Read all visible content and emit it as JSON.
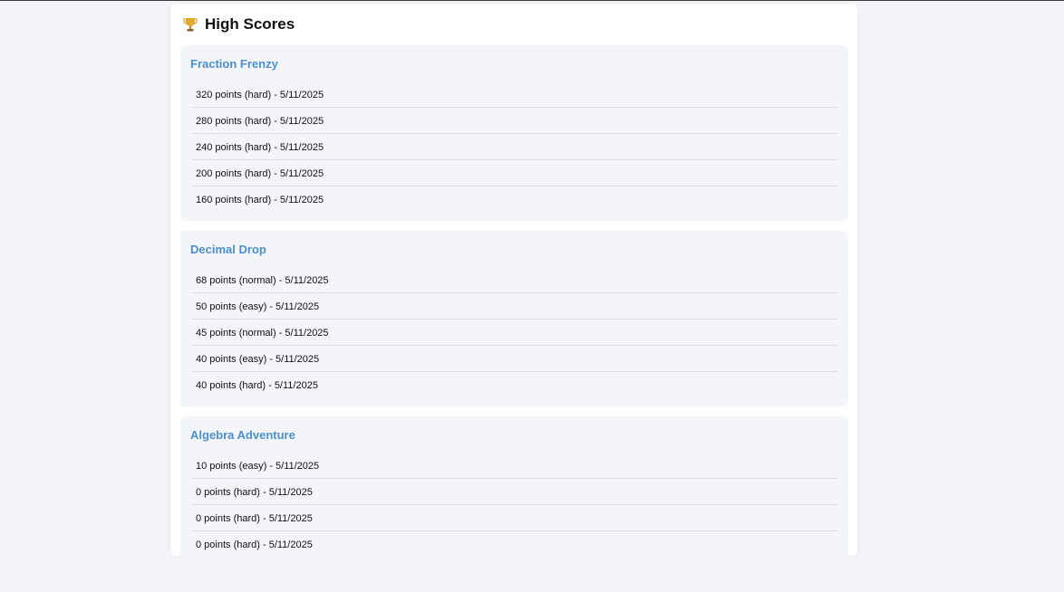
{
  "header": {
    "title": "High Scores",
    "icon": "trophy-icon"
  },
  "games": [
    {
      "name": "Fraction Frenzy",
      "scores": [
        "320 points (hard) - 5/11/2025",
        "280 points (hard) - 5/11/2025",
        "240 points (hard) - 5/11/2025",
        "200 points (hard) - 5/11/2025",
        "160 points (hard) - 5/11/2025"
      ]
    },
    {
      "name": "Decimal Drop",
      "scores": [
        "68 points (normal) - 5/11/2025",
        "50 points (easy) - 5/11/2025",
        "45 points (normal) - 5/11/2025",
        "40 points (easy) - 5/11/2025",
        "40 points (hard) - 5/11/2025"
      ]
    },
    {
      "name": "Algebra Adventure",
      "scores": [
        "10 points (easy) - 5/11/2025",
        "0 points (hard) - 5/11/2025",
        "0 points (hard) - 5/11/2025",
        "0 points (hard) - 5/11/2025"
      ]
    }
  ],
  "colors": {
    "accent": "#4a90d0",
    "card_bg": "#f4f5f9",
    "page_bg": "#f3f4f8"
  }
}
